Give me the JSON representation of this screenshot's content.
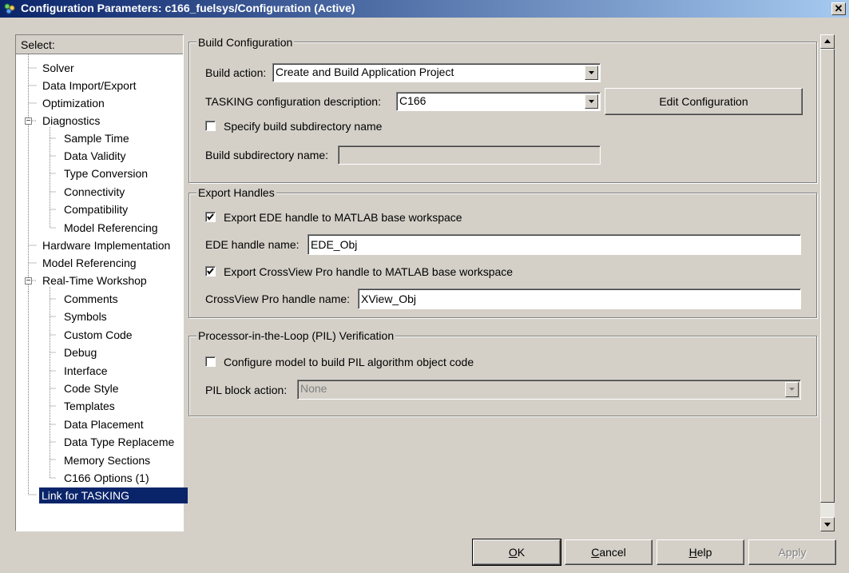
{
  "window": {
    "title": "Configuration Parameters: c166_fuelsys/Configuration (Active)",
    "close_glyph": "✕"
  },
  "tree": {
    "header": "Select:",
    "items": [
      {
        "label": "Solver"
      },
      {
        "label": "Data Import/Export"
      },
      {
        "label": "Optimization"
      },
      {
        "label": "Diagnostics"
      },
      {
        "label": "Sample Time"
      },
      {
        "label": "Data Validity"
      },
      {
        "label": "Type Conversion"
      },
      {
        "label": "Connectivity"
      },
      {
        "label": "Compatibility"
      },
      {
        "label": "Model Referencing"
      },
      {
        "label": "Hardware Implementation"
      },
      {
        "label": "Model Referencing"
      },
      {
        "label": "Real-Time Workshop"
      },
      {
        "label": "Comments"
      },
      {
        "label": "Symbols"
      },
      {
        "label": "Custom Code"
      },
      {
        "label": "Debug"
      },
      {
        "label": "Interface"
      },
      {
        "label": "Code Style"
      },
      {
        "label": "Templates"
      },
      {
        "label": "Data Placement"
      },
      {
        "label": "Data Type Replaceme"
      },
      {
        "label": "Memory Sections"
      },
      {
        "label": "C166 Options (1)"
      },
      {
        "label": "Link for TASKING"
      }
    ],
    "selected": "Link for TASKING",
    "expander": "−"
  },
  "build": {
    "legend": "Build Configuration",
    "action_label": "Build action:",
    "action_value": "Create and Build Application Project",
    "tasking_label": "TASKING configuration description:",
    "tasking_value": "C166",
    "edit_button": "Edit Configuration",
    "subdir_check_label": "Specify build subdirectory name",
    "subdir_checked": false,
    "subdir_label": "Build subdirectory name:",
    "subdir_value": ""
  },
  "export": {
    "legend": "Export Handles",
    "ede_check_label": "Export EDE handle to MATLAB base workspace",
    "ede_checked": true,
    "ede_name_label": "EDE handle name:",
    "ede_name_value": "EDE_Obj",
    "xview_check_label": "Export CrossView Pro handle to MATLAB base workspace",
    "xview_checked": true,
    "xview_name_label": "CrossView Pro handle name:",
    "xview_name_value": "XView_Obj"
  },
  "pil": {
    "legend": "Processor-in-the-Loop (PIL) Verification",
    "config_check_label": "Configure model to build PIL algorithm object code",
    "config_checked": false,
    "action_label": "PIL block action:",
    "action_value": "None"
  },
  "buttons": {
    "ok_mnemonic": "O",
    "ok_rest": "K",
    "cancel_mnemonic": "C",
    "cancel_rest": "ancel",
    "help_mnemonic": "H",
    "help_rest": "elp",
    "apply_label": "Apply"
  },
  "colors": {
    "titlebar_start": "#0a246a",
    "titlebar_end": "#a6caf0",
    "dialog_face": "#d4d0c8",
    "selection": "#0a246a"
  }
}
